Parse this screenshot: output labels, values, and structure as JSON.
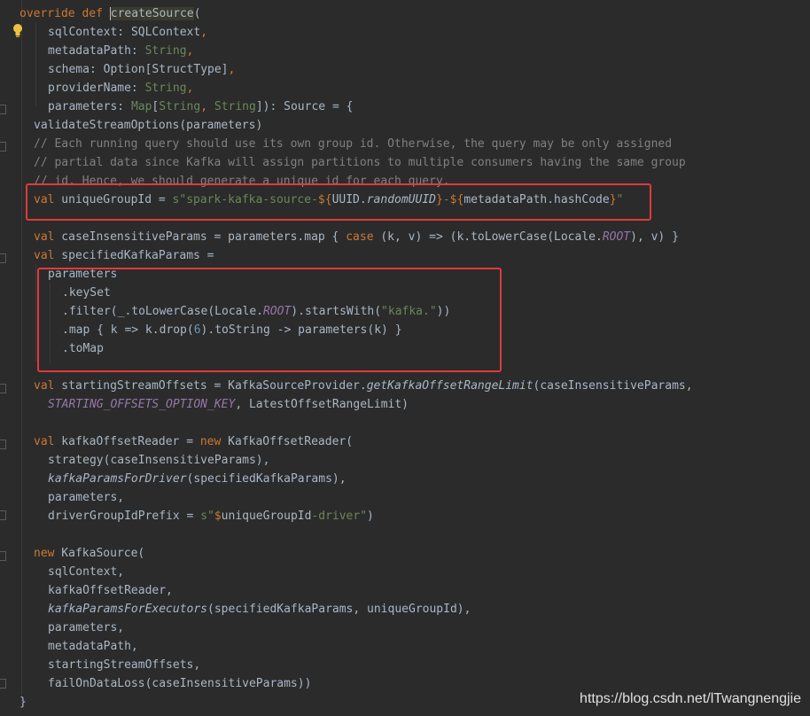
{
  "code": {
    "l1": {
      "kw1": "override",
      "kw2": "def",
      "name": "createSource",
      "open": "("
    },
    "l2": {
      "name": "sqlContext",
      "type": "SQLContext",
      "comma": ","
    },
    "l3": {
      "name": "metadataPath",
      "type": "String",
      "comma": ","
    },
    "l4": {
      "name": "schema",
      "type": "Option[StructType]",
      "comma": ","
    },
    "l5": {
      "name": "providerName",
      "type": "String",
      "comma": ","
    },
    "l6": {
      "name": "parameters",
      "typeA": "Map",
      "lb": "[",
      "t1": "String",
      "sep": ", ",
      "t2": "String",
      "rb": "])",
      "ret": ": Source = {"
    },
    "l7": {
      "text": "validateStreamOptions(parameters)"
    },
    "l8": {
      "text": "// Each running query should use its own group id. Otherwise, the query may be only assigned"
    },
    "l9": {
      "text": "// partial data since Kafka will assign partitions to multiple consumers having the same group"
    },
    "l10": {
      "text": "// id. Hence, we should generate a unique id for each query."
    },
    "l11": {
      "kw": "val",
      "name": " uniqueGroupId = ",
      "s1": "s\"spark-kafka-source-",
      "d1": "${",
      "e1a": "UUID.",
      "e1b": "randomUUID",
      "c1": "}",
      "s2": "-",
      "d2": "${",
      "e2": "metadataPath.hashCode",
      "c2": "}",
      "s3": "\""
    },
    "l12": {
      "kw": "val",
      "a": " caseInsensitiveParams = parameters.map { ",
      "case": "case",
      "b": " (k, v) => (k.toLowerCase(Locale.",
      "root": "ROOT",
      "c": "), v) }"
    },
    "l13": {
      "kw": "val",
      "a": " specifiedKafkaParams ="
    },
    "l14": {
      "text": "parameters"
    },
    "l15": {
      "text": ".keySet"
    },
    "l16": {
      "a": ".filter(_.toLowerCase(Locale.",
      "root": "ROOT",
      "b": ").startsWith(",
      "str": "\"kafka.\"",
      "c": "))"
    },
    "l17": {
      "a": ".map { k => k.drop(",
      "num": "6",
      "b": ").toString -> parameters(k) }"
    },
    "l18": {
      "text": ".toMap"
    },
    "l19": {
      "kw": "val",
      "a": " startingStreamOffsets = KafkaSourceProvider.",
      "m": "getKafkaOffsetRangeLimit",
      "b": "(caseInsensitiveParams,"
    },
    "l20": {
      "cst": "STARTING_OFFSETS_OPTION_KEY",
      "a": ", LatestOffsetRangeLimit)"
    },
    "l21": {
      "kw": "val",
      "a": " kafkaOffsetReader = ",
      "new": "new",
      "b": " KafkaOffsetReader("
    },
    "l22": {
      "text": "strategy(caseInsensitiveParams),"
    },
    "l23": {
      "m": "kafkaParamsForDriver",
      "a": "(specifiedKafkaParams),"
    },
    "l24": {
      "text": "parameters,"
    },
    "l25": {
      "a": "driverGroupIdPrefix = ",
      "s1": "s\"",
      "d": "$",
      "v": "uniqueGroupId",
      "s2": "-driver\"",
      "b": ")"
    },
    "l26": {
      "new": "new",
      "a": " KafkaSource("
    },
    "l27": {
      "text": "sqlContext,"
    },
    "l28": {
      "text": "kafkaOffsetReader,"
    },
    "l29": {
      "m": "kafkaParamsForExecutors",
      "a": "(specifiedKafkaParams, uniqueGroupId),"
    },
    "l30": {
      "text": "parameters,"
    },
    "l31": {
      "text": "metadataPath,"
    },
    "l32": {
      "text": "startingStreamOffsets,"
    },
    "l33": {
      "text": "failOnDataLoss(caseInsensitiveParams))"
    },
    "l34": {
      "text": "}"
    }
  },
  "watermark": "https://blog.csdn.net/lTwangnengjie",
  "colors": {
    "background": "#2b2b2b",
    "keyword": "#cc7832",
    "string": "#6a8759",
    "comment": "#808080",
    "constant": "#9876aa",
    "highlight_box": "#e03a3a"
  },
  "icons": {
    "gutter": "lightbulb-icon"
  }
}
